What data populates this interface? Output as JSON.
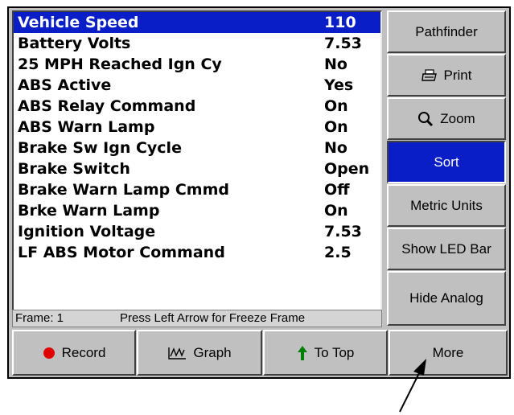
{
  "rows": [
    {
      "label": "Vehicle Speed",
      "value": "110",
      "selected": true
    },
    {
      "label": "Battery Volts",
      "value": "7.53"
    },
    {
      "label": "25 MPH Reached Ign Cy",
      "value": "No"
    },
    {
      "label": "ABS Active",
      "value": "Yes"
    },
    {
      "label": "ABS Relay Command",
      "value": "On"
    },
    {
      "label": "ABS Warn Lamp",
      "value": "On"
    },
    {
      "label": "Brake Sw Ign Cycle",
      "value": "No"
    },
    {
      "label": "Brake Switch",
      "value": "Open"
    },
    {
      "label": "Brake Warn Lamp Cmmd",
      "value": "Off"
    },
    {
      "label": "Brke Warn Lamp",
      "value": "On"
    },
    {
      "label": "Ignition Voltage",
      "value": "7.53"
    },
    {
      "label": "LF ABS Motor Command",
      "value": "2.5"
    }
  ],
  "status": {
    "frame": "Frame: 1",
    "hint": "Press Left Arrow for Freeze Frame"
  },
  "side_buttons": {
    "pathfinder": "Pathfinder",
    "print": "Print",
    "zoom": "Zoom",
    "sort": "Sort",
    "metric_units": "Metric Units",
    "show_led_bar": "Show LED Bar",
    "hide_analog": "Hide Analog"
  },
  "bottom_buttons": {
    "record": "Record",
    "graph": "Graph",
    "to_top": "To Top",
    "more": "More"
  },
  "colors": {
    "selection": "#0a1ec8",
    "record_dot": "#e00000",
    "to_top_arrow": "#008000"
  }
}
